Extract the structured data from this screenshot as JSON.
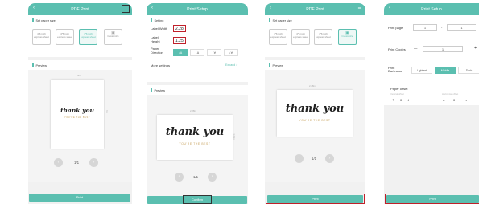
{
  "screen1": {
    "title": "PDF Print",
    "back_icon": "chevron-left-icon",
    "section_paper": "Set paper size",
    "options": [
      "4*6 inch express sheet",
      "4*6 inch express sheet",
      "4*6 inch express sheet",
      "Customize"
    ],
    "section_preview": "Preview",
    "dim_w": "4in",
    "dim_h": "6in",
    "card_script": "thank you",
    "card_sub": "YOU'RE THE BEST",
    "pager": "1/1",
    "print_button": "Print"
  },
  "screen2": {
    "title": "Print Setup",
    "section_setting": "Setting",
    "label_width_label": "Label Width",
    "label_width_value": "2.28",
    "label_height_label": "Label Height",
    "label_height_value": "1.25",
    "paper_direction_label": "Paper Direction",
    "directions": [
      "↓A",
      "↓A",
      "↓∀",
      "↓∀"
    ],
    "more_settings": "More settings",
    "expand": "Expand >",
    "section_preview": "Preview",
    "dim_w": "2.28in",
    "dim_h": "1.25in",
    "card_script": "thank you",
    "card_sub": "YOU'RE THE BEST",
    "pager": "1/1",
    "confirm_button": "Confirm"
  },
  "screen3": {
    "title": "PDF Print",
    "section_paper": "Set paper size",
    "options": [
      "4*6 inch express sheet",
      "4*6 inch express sheet",
      "4*6 inch express sheet",
      "Customize"
    ],
    "section_preview": "Preview",
    "dim_w": "2.28in",
    "card_script": "thank you",
    "card_sub": "YOU'RE THE BEST",
    "pager": "1/1",
    "print_button": "Print"
  },
  "screen4": {
    "title": "Print Setup",
    "print_page_label": "Print page",
    "print_page_from": "1",
    "print_page_sep": "-",
    "print_page_to": "1",
    "print_copies_label": "Print Copies",
    "minus": "—",
    "copies_value": "1",
    "plus": "+",
    "darkness_label": "Print Darkness",
    "darkness_options": [
      "Lightest",
      "Middle",
      "Dark"
    ],
    "paper_offset_label": "Paper offset",
    "vertical_label": "Vertical offset",
    "horizontal_label": "Horizontal offset",
    "offset_value": "0",
    "print_button": "Print"
  }
}
